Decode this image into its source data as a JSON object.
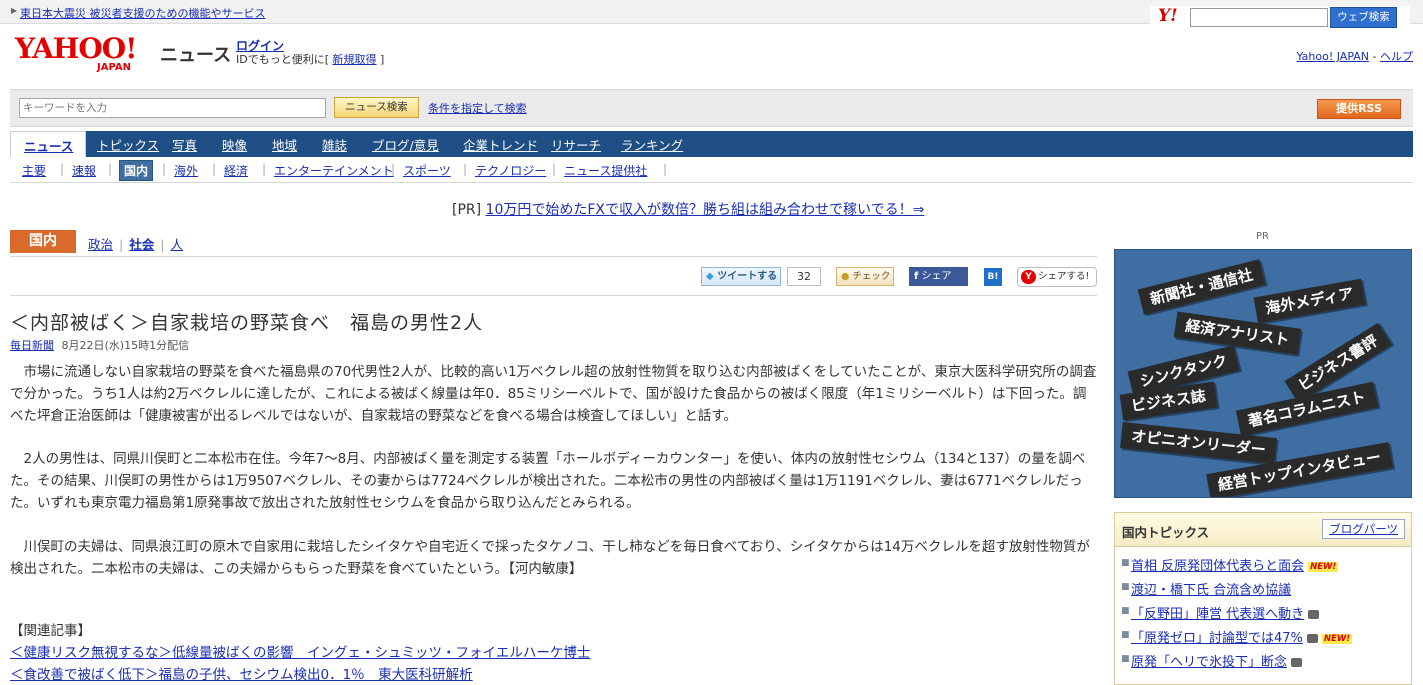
{
  "topstrip": {
    "notice": "東日本大震災 被災者支援のための機能やサービス"
  },
  "websearch": {
    "logo": "Y!",
    "button": "ウェブ検索"
  },
  "header": {
    "logo_main": "YAHOO!",
    "logo_sub": "JAPAN",
    "section": "ニュース",
    "login": "ログイン",
    "id_prefix": "IDでもっと便利に[",
    "register": "新規取得",
    "id_suffix": "]",
    "right_link1": "Yahoo! JAPAN",
    "right_sep": "-",
    "right_link2": "ヘルプ"
  },
  "search": {
    "placeholder": "キーワードを入力",
    "button": "ニュース検索",
    "advanced": "条件を指定して検索",
    "rss": "提供RSS"
  },
  "nav1": [
    "ニュース",
    "トピックス",
    "写真",
    "映像",
    "地域",
    "雑誌",
    "ブログ/意見",
    "企業トレンド",
    "リサーチ",
    "ランキング"
  ],
  "nav2": [
    "主要",
    "速報",
    "国内",
    "海外",
    "経済",
    "エンターテインメント",
    "スポーツ",
    "テクノロジー",
    "ニュース提供社"
  ],
  "pr": {
    "prefix": "[PR]",
    "link": "10万円で始めたFXで収入が数倍？勝ち組は組み合わせで稼いでる！⇒"
  },
  "category": {
    "badge": "国内",
    "links": [
      "政治",
      "社会",
      "人"
    ]
  },
  "share": {
    "tweet": "ツイートする",
    "tweet_count": "32",
    "mixi": "チェック",
    "facebook": "シェア",
    "hatena": "B!",
    "yahoo": "シェアする!"
  },
  "article": {
    "title": "＜内部被ばく＞自家栽培の野菜食べ　福島の男性2人",
    "source": "毎日新聞",
    "date": "8月22日(水)15時1分配信",
    "paragraphs": [
      "　市場に流通しない自家栽培の野菜を食べた福島県の70代男性2人が、比較的高い1万ベクレル超の放射性物質を取り込む内部被ばくをしていたことが、東京大医科学研究所の調査で分かった。うち1人は約2万ベクレルに達したが、これによる被ばく線量は年0．85ミリシーベルトで、国が設けた食品からの被ばく限度（年1ミリシーベルト）は下回った。調べた坪倉正治医師は「健康被害が出るレベルではないが、自家栽培の野菜などを食べる場合は検査してほしい」と話す。",
      "　2人の男性は、同県川俣町と二本松市在住。今年7～8月、内部被ばく量を測定する装置「ホールボディーカウンター」を使い、体内の放射性セシウム（134と137）の量を調べた。その結果、川俣町の男性からは1万9507ベクレル、その妻からは7724ベクレルが検出された。二本松市の男性の内部被ばく量は1万1191ベクレル、妻は6771ベクレルだった。いずれも東京電力福島第1原発事故で放出された放射性セシウムを食品から取り込んだとみられる。",
      "　川俣町の夫婦は、同県浪江町の原木で自家用に栽培したシイタケや自宅近くで採ったタケノコ、干し柿などを毎日食べており、シイタケからは14万ベクレルを超す放射性物質が検出された。二本松市の夫婦は、この夫婦からもらった野菜を食べていたという。【河内敏康】"
    ],
    "related_heading": "【関連記事】",
    "related": [
      "＜健康リスク無視するな＞低線量被ばくの影響　イングェ・シュミッツ・フォイエルハーケ博士",
      "＜食改善で被ばく低下＞福島の子供、セシウム検出0．1％　東大医科研解析"
    ]
  },
  "sidebar": {
    "pr_label": "PR",
    "ad_bands": [
      "新聞社・通信社",
      "海外メディア",
      "経済アナリスト",
      "シンクタンク",
      "ビジネス書評",
      "ビジネス誌",
      "著名コラムニスト",
      "オピニオンリーダー",
      "経営トップインタビュー"
    ],
    "topics_title": "国内トピックス",
    "topics_button": "ブログパーツ",
    "topics": [
      {
        "text": "首相 反原発団体代表らと面会",
        "badge": "NEW!"
      },
      {
        "text": "渡辺・橋下氏 合流含め協議",
        "badge": ""
      },
      {
        "text": "「反野田」陣営 代表選へ動き",
        "badge": ""
      },
      {
        "text": "「原発ゼロ」討論型では47%",
        "badge": "NEW!"
      },
      {
        "text": "原発「ヘリで氷投下」断念",
        "badge": ""
      }
    ],
    "accent_color": "#1e4e83",
    "category_color": "#d86a2b"
  }
}
